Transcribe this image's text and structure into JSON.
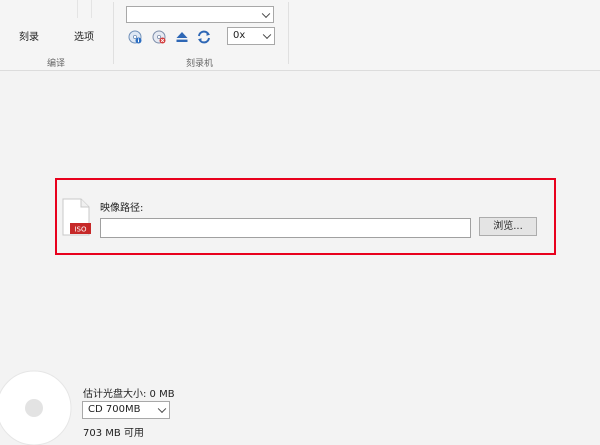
{
  "ribbon": {
    "burn_label": "刻录",
    "options_label": "选项",
    "edit_group_label": "编译",
    "recorder_group_label": "刻录机",
    "drive_select_value": "",
    "speed_select_value": "0x",
    "icons": [
      "disc-info-icon",
      "erase-disc-icon",
      "eject-icon",
      "refresh-icon"
    ]
  },
  "image": {
    "path_label": "映像路径:",
    "path_value": "",
    "browse_label": "浏览...",
    "iso_badge": "ISO",
    "highlight_color": "#e8001c"
  },
  "disc": {
    "estimated_size": "估计光盘大小: 0 MB",
    "type_value": "CD 700MB",
    "available": "703 MB 可用"
  }
}
